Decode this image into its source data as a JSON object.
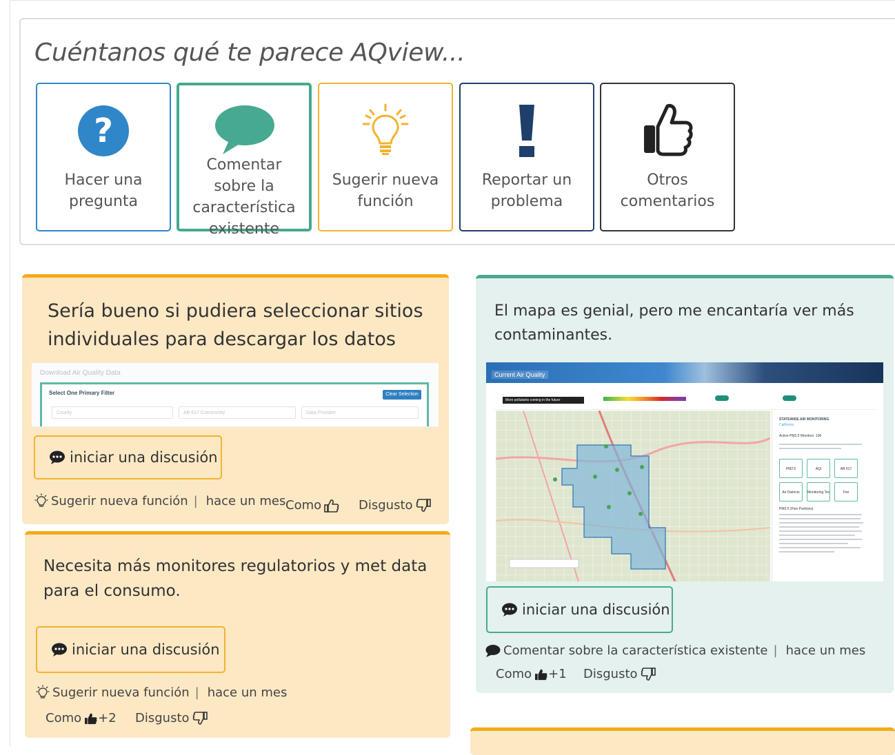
{
  "feedback": {
    "title": "Cuéntanos qué te parece AQview...",
    "categories": [
      {
        "id": "question",
        "label": "Hacer una pregunta",
        "color": "#2f86c8",
        "icon": "question-circle-icon"
      },
      {
        "id": "comment",
        "label": "Comentar sobre la característica existente",
        "color": "#47a98f",
        "icon": "speech-bubble-icon"
      },
      {
        "id": "suggest",
        "label": "Sugerir nueva función",
        "color": "#f2b32e",
        "icon": "lightbulb-icon"
      },
      {
        "id": "report",
        "label": "Reportar un problema",
        "color": "#1e3f6a",
        "icon": "exclamation-icon"
      },
      {
        "id": "other",
        "label": "Otros comentarios",
        "color": "#333333",
        "icon": "thumbs-up-icon"
      }
    ]
  },
  "posts": [
    {
      "text": "Sería bueno si pudiera seleccionar sitios individuales para descargar los datos",
      "discuss_label": "iniciar una discusión",
      "category": "Sugerir nueva función",
      "time": "hace un mes",
      "like_label": "Como",
      "like_count": "",
      "dislike_label": "Disgusto",
      "screenshot": {
        "title": "Download Air Quality Data",
        "filter_label": "Select One Primary Filter",
        "clear_label": "Clear Selection",
        "selects": [
          "County",
          "AB 617 Community",
          "Data Provider"
        ]
      }
    },
    {
      "text": "Necesita más monitores regulatorios y met data para el consumo.",
      "discuss_label": "iniciar una discusión",
      "category": "Sugerir nueva función",
      "time": "hace un mes",
      "like_label": "Como",
      "like_count": "+2",
      "dislike_label": "Disgusto"
    },
    {
      "text": "El mapa es genial, pero me encantaría ver más contaminantes.",
      "discuss_label": "iniciar una discusión",
      "category": "Comentar sobre la característica existente",
      "time": "hace un mes",
      "like_label": "Como",
      "like_count": "+1",
      "dislike_label": "Disgusto",
      "screenshot": {
        "banner": "Current Air Quality",
        "tooltip": "More pollutants coming in the future",
        "side_title": "STATEWIDE AIR MONITORING",
        "side_region": "California",
        "side_count": "Active PM2.5 Monitors: 136",
        "tiles": [
          "PM2.5",
          "AQI",
          "AB 617",
          "Air Districts",
          "Monitoring Technology",
          "Fire"
        ],
        "pm_heading": "PM2.5 (Fine Particles)"
      }
    }
  ]
}
